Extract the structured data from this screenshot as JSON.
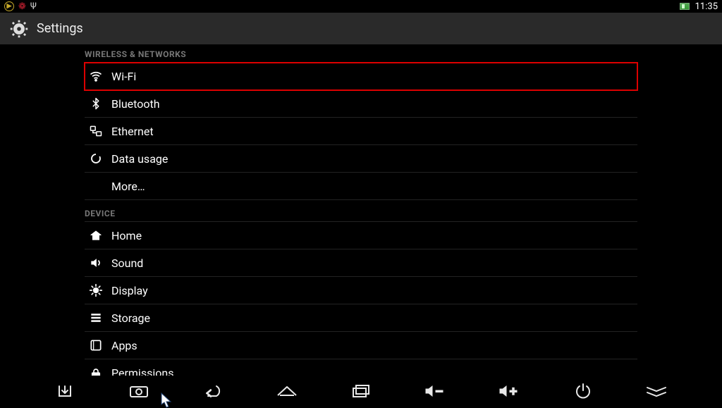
{
  "status": {
    "time": "11:35"
  },
  "header": {
    "title": "Settings"
  },
  "sections": [
    {
      "title": "WIRELESS & NETWORKS",
      "items": [
        {
          "key": "wifi",
          "label": "Wi-Fi",
          "icon": "wifi-icon",
          "highlighted": true
        },
        {
          "key": "bluetooth",
          "label": "Bluetooth",
          "icon": "bluetooth-icon"
        },
        {
          "key": "ethernet",
          "label": "Ethernet",
          "icon": "ethernet-icon"
        },
        {
          "key": "datausage",
          "label": "Data usage",
          "icon": "data-usage-icon"
        },
        {
          "key": "more",
          "label": "More…",
          "icon": ""
        }
      ]
    },
    {
      "title": "DEVICE",
      "items": [
        {
          "key": "home",
          "label": "Home",
          "icon": "home-icon"
        },
        {
          "key": "sound",
          "label": "Sound",
          "icon": "sound-icon"
        },
        {
          "key": "display",
          "label": "Display",
          "icon": "display-icon"
        },
        {
          "key": "storage",
          "label": "Storage",
          "icon": "storage-icon"
        },
        {
          "key": "apps",
          "label": "Apps",
          "icon": "apps-icon"
        },
        {
          "key": "permissions",
          "label": "Permissions",
          "icon": "permissions-icon"
        }
      ]
    }
  ],
  "icon_names": {
    "status_app": "plex-icon",
    "status_berry": "raspberry-icon",
    "status_usb": "usb-icon",
    "status_tray": "network-tray-icon"
  },
  "nav": [
    {
      "key": "download",
      "icon": "download-icon"
    },
    {
      "key": "screenshot",
      "icon": "screenshot-icon"
    },
    {
      "key": "back",
      "icon": "back-icon"
    },
    {
      "key": "home",
      "icon": "home-nav-icon"
    },
    {
      "key": "recent",
      "icon": "recent-apps-icon"
    },
    {
      "key": "voldown",
      "icon": "volume-down-icon"
    },
    {
      "key": "volup",
      "icon": "volume-up-icon"
    },
    {
      "key": "power",
      "icon": "power-icon"
    },
    {
      "key": "hide",
      "icon": "hide-bar-icon"
    }
  ]
}
